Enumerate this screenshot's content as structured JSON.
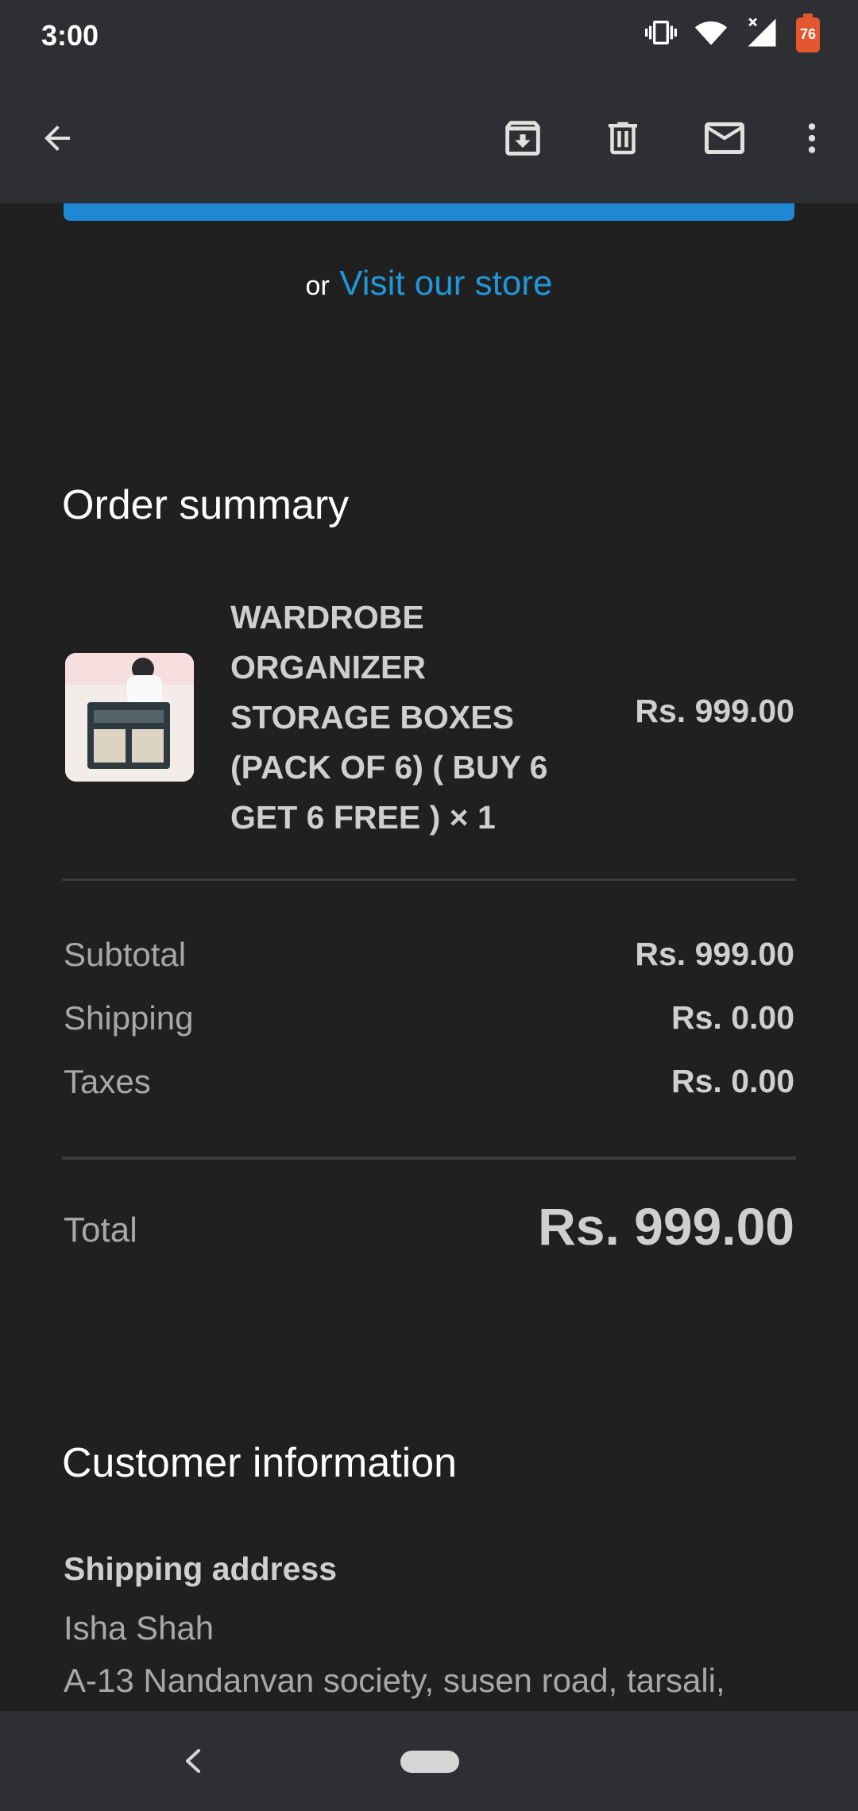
{
  "status_bar": {
    "time": "3:00",
    "battery_level": "76",
    "icons": [
      "vibrate-icon",
      "wifi-icon",
      "signal-icon",
      "battery-icon"
    ]
  },
  "toolbar": {
    "icons": [
      "back-arrow-icon",
      "archive-icon",
      "delete-icon",
      "mark-unread-icon",
      "more-vert-icon"
    ]
  },
  "email": {
    "or_text": "or",
    "visit_store_link": "Visit our store",
    "order_summary": {
      "title": "Order summary",
      "item": {
        "name_lines": [
          "WARDROBE",
          "ORGANIZER",
          "STORAGE BOXES",
          "(PACK OF 6) ( BUY 6",
          "GET 6 FREE ) × 1"
        ],
        "price": "Rs. 999.00"
      },
      "subtotal_label": "Subtotal",
      "subtotal_value": "Rs. 999.00",
      "shipping_label": "Shipping",
      "shipping_value": "Rs. 0.00",
      "taxes_label": "Taxes",
      "taxes_value": "Rs. 0.00",
      "total_label": "Total",
      "total_value": "Rs. 999.00"
    },
    "customer_info": {
      "title": "Customer information",
      "shipping_address_heading": "Shipping address",
      "name": "Isha Shah",
      "address_line": "A-13 Nandanvan society, susen road, tarsali,"
    }
  },
  "colors": {
    "link": "#2196d9",
    "cta_button": "#1e88d4",
    "battery": "#e4572e",
    "background": "#202020",
    "bar": "#2d2f33"
  }
}
